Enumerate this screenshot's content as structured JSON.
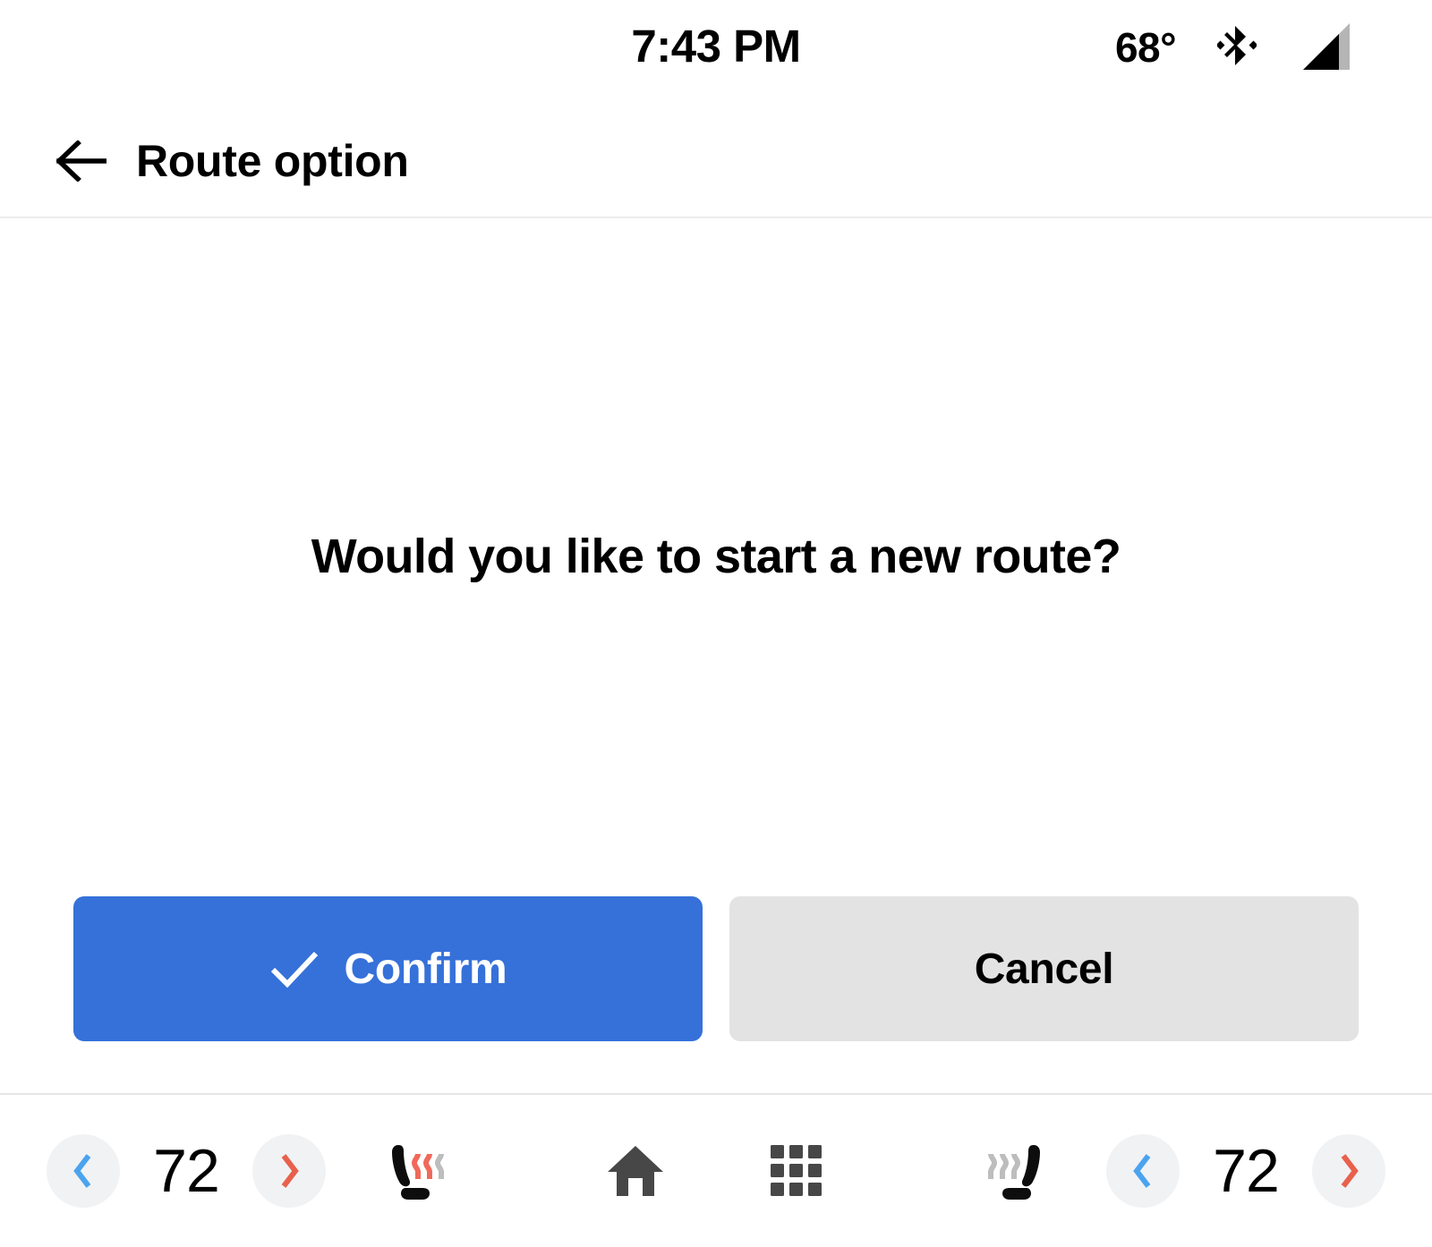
{
  "status_bar": {
    "clock": "7:43 PM",
    "temperature": "68°",
    "bluetooth_icon": "bluetooth-icon",
    "signal_icon": "cellular-signal-icon"
  },
  "app_bar": {
    "back_icon": "back-arrow-icon",
    "title": "Route option"
  },
  "main": {
    "prompt": "Would you like to start a new route?",
    "buttons": {
      "confirm": {
        "label": "Confirm",
        "icon": "check-icon",
        "bg_color": "#3571D9",
        "text_color": "#FFFFFF"
      },
      "cancel": {
        "label": "Cancel",
        "bg_color": "#E3E3E3",
        "text_color": "#000000"
      }
    }
  },
  "climate_bar": {
    "left": {
      "decrease_icon": "chevron-left-icon",
      "decrease_color": "#4BA3EE",
      "value": "72",
      "increase_icon": "chevron-right-icon",
      "increase_color": "#E8614C",
      "seat_heater_icon": "heated-seat-icon",
      "seat_heater_level": 2,
      "seat_heater_levels_total": 3
    },
    "center": {
      "home_icon": "home-icon",
      "apps_icon": "apps-grid-icon",
      "icon_color": "#474747"
    },
    "right": {
      "seat_heater_icon": "heated-seat-icon",
      "seat_heater_level": 0,
      "seat_heater_levels_total": 3,
      "decrease_icon": "chevron-left-icon",
      "decrease_color": "#4BA3EE",
      "value": "72",
      "increase_icon": "chevron-right-icon",
      "increase_color": "#E8614C"
    },
    "colors": {
      "button_bg": "#F1F2F4",
      "heat_active": "#F0695A",
      "heat_inactive": "#BDBDBD"
    }
  }
}
